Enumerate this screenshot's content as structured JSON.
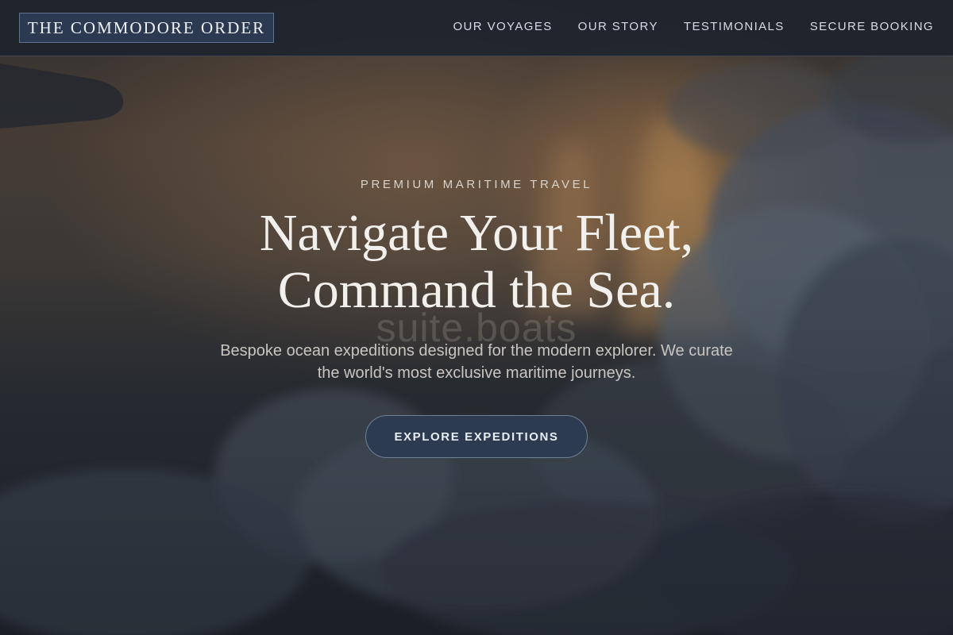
{
  "brand": {
    "name": "THE COMMODORE ORDER"
  },
  "nav": {
    "links": [
      {
        "label": "OUR VOYAGES"
      },
      {
        "label": "OUR STORY"
      },
      {
        "label": "TESTIMONIALS"
      },
      {
        "label": "SECURE BOOKING"
      }
    ]
  },
  "hero": {
    "eyebrow": "PREMIUM MARITIME TRAVEL",
    "headline_line1": "Navigate Your Fleet,",
    "headline_line2": "Command the Sea.",
    "watermark": "suite.boats",
    "subtext": "Bespoke ocean expeditions designed for the modern explorer. We curate the world's most exclusive maritime journeys.",
    "cta_label": "EXPLORE EXPEDITIONS"
  },
  "colors": {
    "navbar_bg": "#1e242d",
    "accent_navy": "#2c3b50",
    "text_light": "#f2f0ec",
    "sunset_glow": "#c48c50"
  }
}
